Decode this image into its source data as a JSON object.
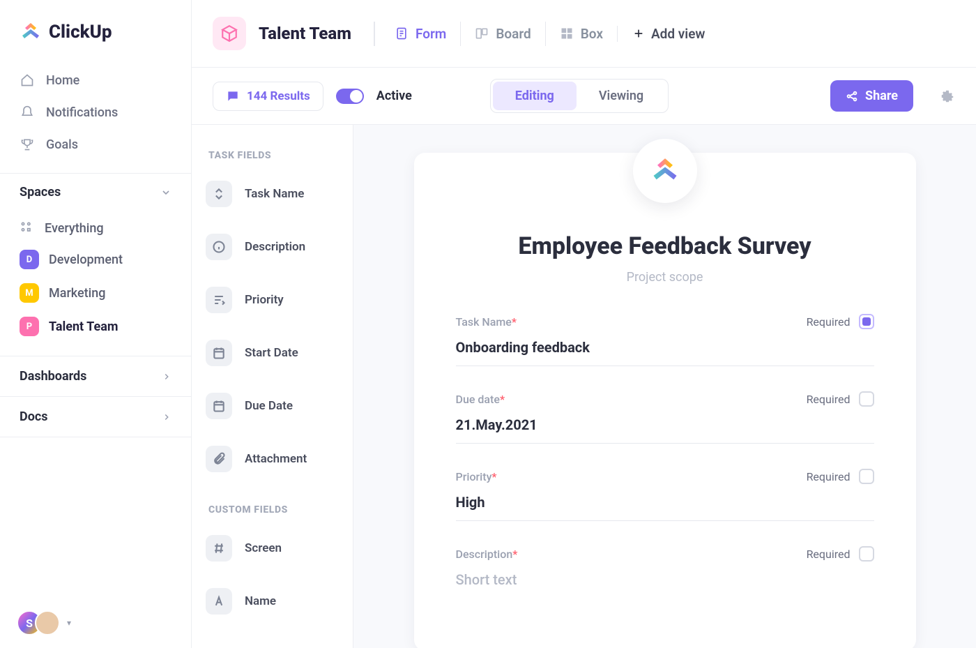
{
  "brand": "ClickUp",
  "sidebar": {
    "nav": [
      {
        "label": "Home"
      },
      {
        "label": "Notifications"
      },
      {
        "label": "Goals"
      }
    ],
    "spaces_header": "Spaces",
    "everything": "Everything",
    "spaces": [
      {
        "letter": "D",
        "label": "Development",
        "color": "badge-d"
      },
      {
        "letter": "M",
        "label": "Marketing",
        "color": "badge-m"
      },
      {
        "letter": "P",
        "label": "Talent Team",
        "color": "badge-p",
        "active": true
      }
    ],
    "dashboards": "Dashboards",
    "docs": "Docs",
    "user_initial": "S"
  },
  "header": {
    "title": "Talent Team",
    "tabs": [
      {
        "label": "Form",
        "active": true
      },
      {
        "label": "Board"
      },
      {
        "label": "Box"
      }
    ],
    "add_view": "Add view"
  },
  "subbar": {
    "results": "144 Results",
    "active_label": "Active",
    "mode": {
      "editing": "Editing",
      "viewing": "Viewing"
    },
    "share": "Share"
  },
  "fields_panel": {
    "task_header": "TASK FIELDS",
    "task_fields": [
      {
        "label": "Task Name",
        "icon": "expand"
      },
      {
        "label": "Description",
        "icon": "info"
      },
      {
        "label": "Priority",
        "icon": "priority"
      },
      {
        "label": "Start Date",
        "icon": "date"
      },
      {
        "label": "Due Date",
        "icon": "date"
      },
      {
        "label": "Attachment",
        "icon": "clip"
      }
    ],
    "custom_header": "CUSTOM FIELDS",
    "custom_fields": [
      {
        "label": "Screen",
        "icon": "hash"
      },
      {
        "label": "Name",
        "icon": "text"
      }
    ]
  },
  "form": {
    "title": "Employee Feedback Survey",
    "subtitle": "Project scope",
    "required_label": "Required",
    "fields": [
      {
        "label": "Task Name",
        "value": "Onboarding feedback",
        "required": true,
        "checked": true
      },
      {
        "label": "Due date",
        "value": "21.May.2021",
        "required": true,
        "checked": false
      },
      {
        "label": "Priority",
        "value": "High",
        "required": true,
        "checked": false
      },
      {
        "label": "Description",
        "value": "Short text",
        "required": true,
        "checked": false,
        "placeholder": true
      }
    ]
  }
}
